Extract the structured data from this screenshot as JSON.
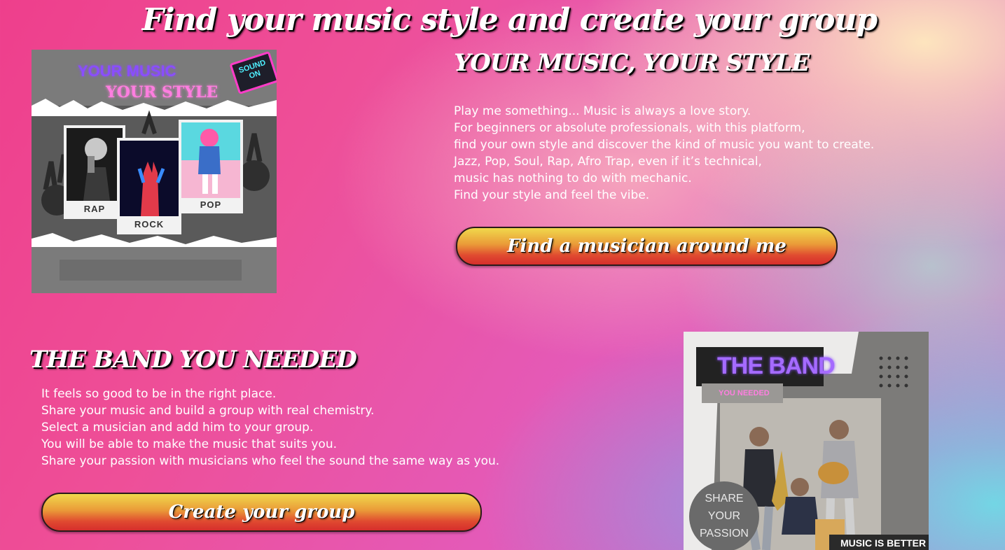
{
  "page": {
    "title": "Find your music style and create your group"
  },
  "section1": {
    "heading": "YOUR MUSIC, YOUR STYLE",
    "lines": [
      "Play me something... Music is always a love story.",
      "For beginners or absolute professionals, with this platform,",
      "find your own style and discover the kind of music you want to create.",
      "Jazz, Pop, Soul, Rap, Afro Trap, even if it’s technical,",
      "music has nothing to do with mechanic.",
      "Find your style and feel the vibe."
    ],
    "button": "Find a musician around me",
    "poster": {
      "line1": "YOUR MUSIC",
      "line2": "YOUR STYLE",
      "badge_top": "SOUND",
      "badge_bottom": "ON",
      "card_labels": [
        "RAP",
        "ROCK",
        "POP"
      ]
    }
  },
  "section2": {
    "heading": "THE BAND YOU NEEDED",
    "lines": [
      "It feels so good to be in the right place.",
      "Share your music and build a group with real chemistry.",
      "Select a musician and add him to your group.",
      "You will be able to make the music that suits you.",
      "Share your passion with musicians who feel the sound the same way as you."
    ],
    "button": "Create your group",
    "poster": {
      "title": "THE BAND",
      "subtitle": "YOU NEEDED",
      "circle_lines": [
        "SHARE",
        "YOUR",
        "PASSION"
      ],
      "footer": "MUSIC IS BETTER"
    }
  },
  "colors": {
    "button_top": "#f0d84c",
    "button_bottom": "#d62e2c",
    "neon_purple": "#8a4dff",
    "neon_pink": "#ff7ee0"
  }
}
